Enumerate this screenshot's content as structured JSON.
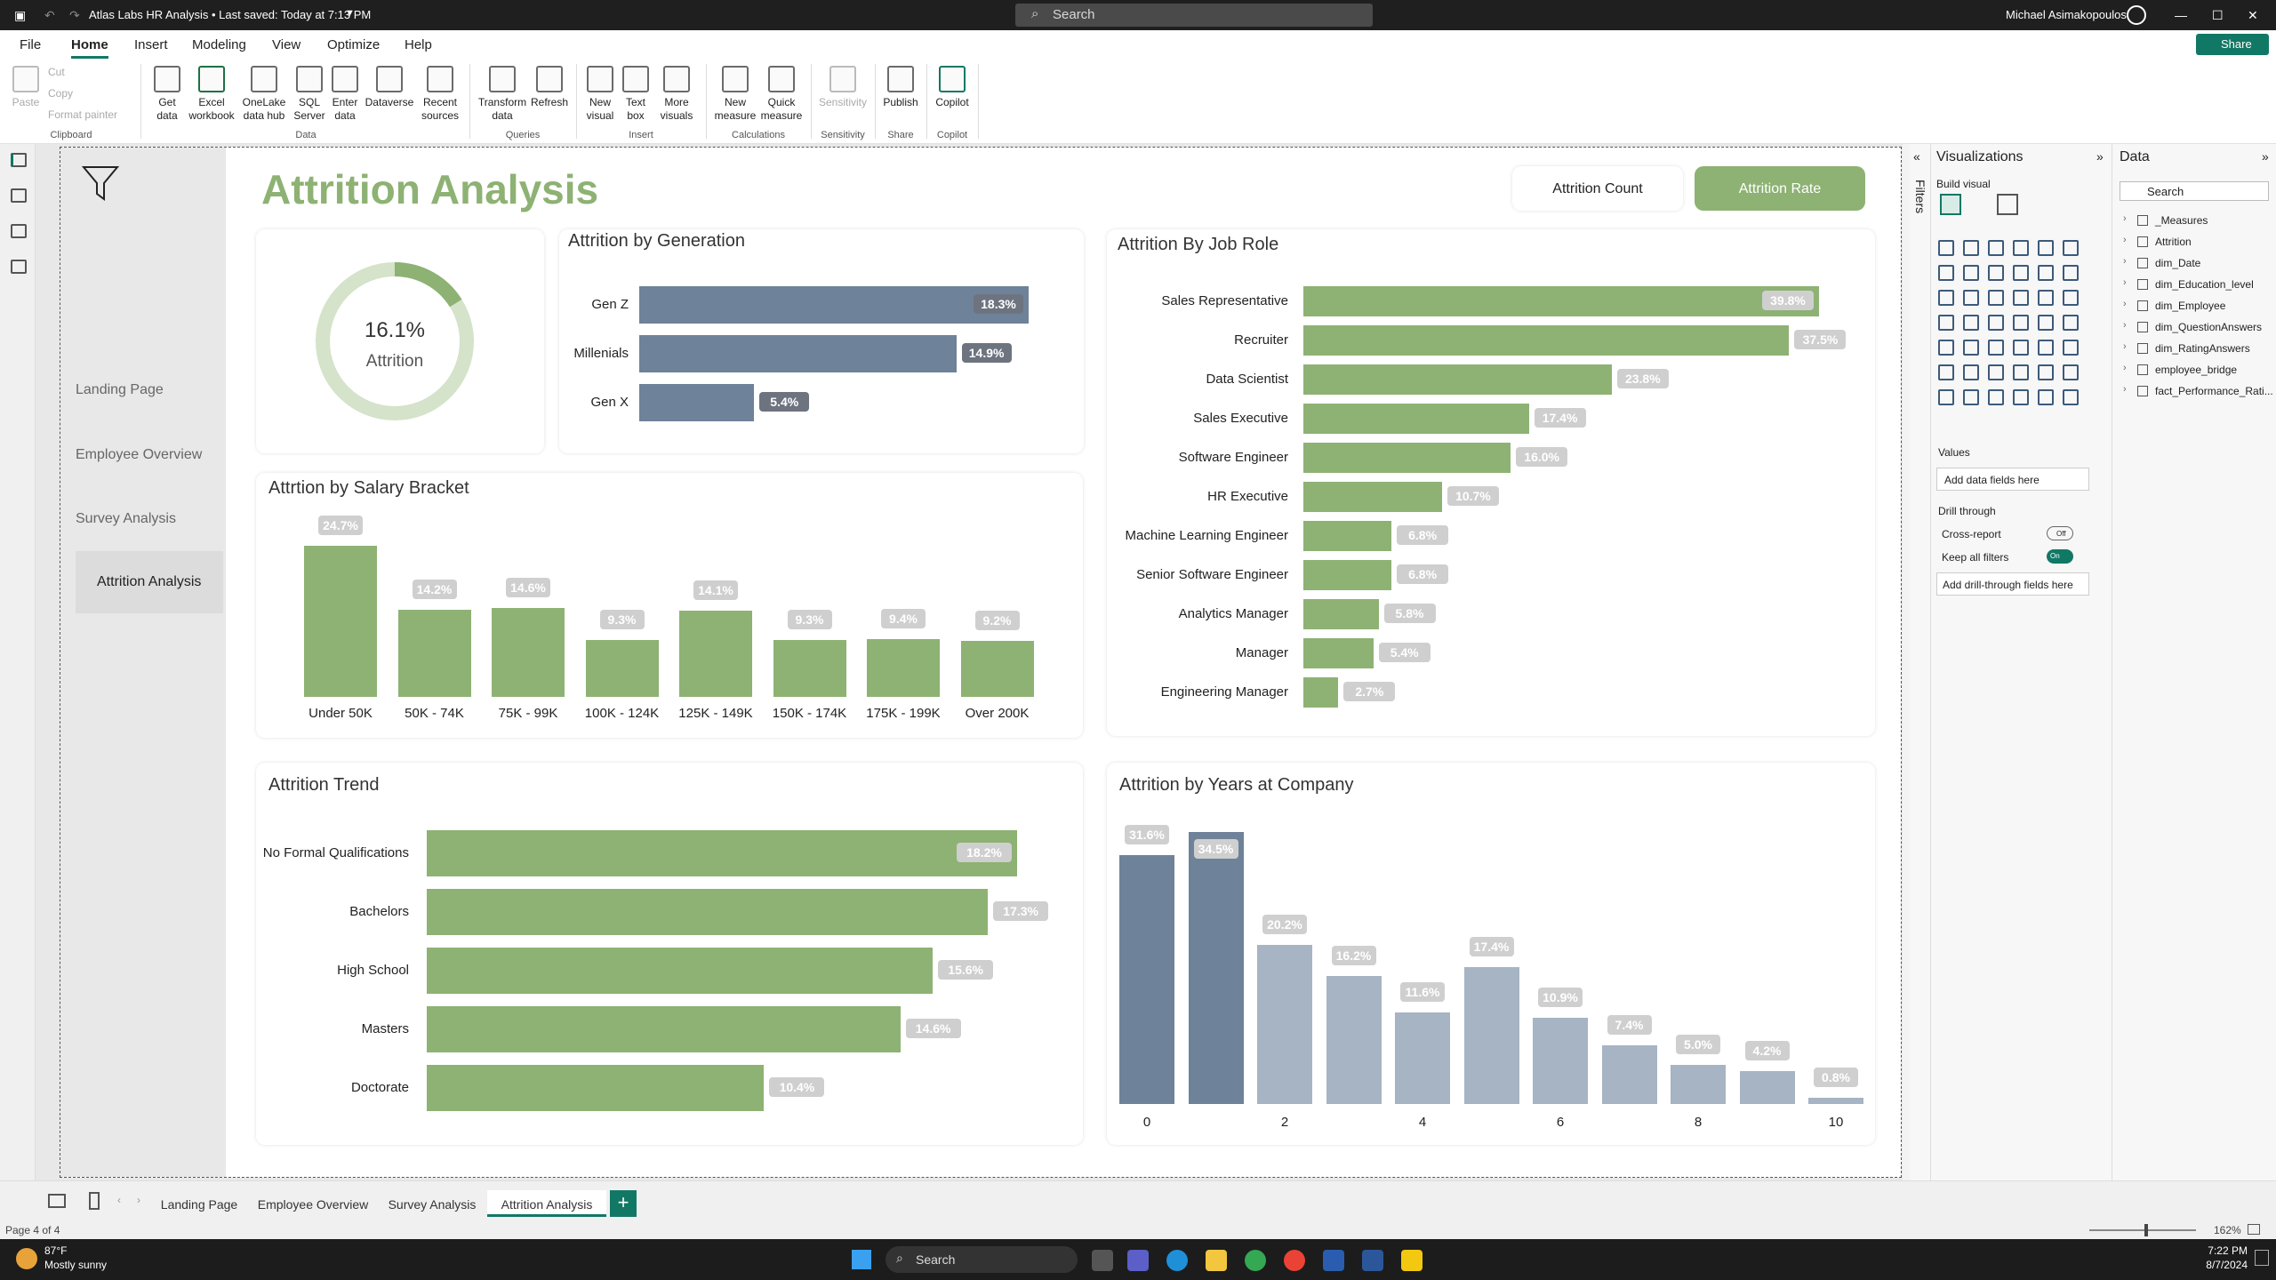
{
  "titlebar": {
    "title": "Atlas Labs HR Analysis • Last saved: Today at 7:13 PM",
    "search_placeholder": "Search",
    "user": "Michael Asimakopoulos",
    "share": "Share"
  },
  "menu": [
    "File",
    "Home",
    "Insert",
    "Modeling",
    "View",
    "Optimize",
    "Help"
  ],
  "ribbon": {
    "clipboard": {
      "paste": "Paste",
      "cut": "Cut",
      "copy": "Copy",
      "format_painter": "Format painter",
      "group": "Clipboard"
    },
    "data": {
      "items": [
        "Get data",
        "Excel workbook",
        "OneLake data hub",
        "SQL Server",
        "Enter data",
        "Dataverse",
        "Recent sources"
      ],
      "group": "Data"
    },
    "queries": {
      "items": [
        "Transform data",
        "Refresh"
      ],
      "group": "Queries"
    },
    "insert": {
      "items": [
        "New visual",
        "Text box",
        "More visuals"
      ],
      "group": "Insert"
    },
    "calculations": {
      "items": [
        "New measure",
        "Quick measure"
      ],
      "group": "Calculations"
    },
    "sensitivity": {
      "items": [
        "Sensitivity"
      ],
      "group": "Sensitivity"
    },
    "share": {
      "items": [
        "Publish"
      ],
      "group": "Share"
    },
    "copilot": {
      "items": [
        "Copilot"
      ],
      "group": "Copilot"
    }
  },
  "report": {
    "title": "Attrition Analysis",
    "toggle_count": "Attrition Count",
    "toggle_rate": "Attrition Rate",
    "nav": [
      "Landing Page",
      "Employee Overview",
      "Survey Analysis",
      "Attrition Analysis"
    ],
    "kpi": {
      "value": "16.1%",
      "label": "Attrition",
      "fraction": 0.161
    },
    "colors": {
      "green": "#8db273",
      "slate": "#6e8299",
      "slate_light": "#a6b4c4",
      "title_green": "#8db273"
    }
  },
  "chart_data": [
    {
      "type": "bar",
      "title": "Attrition by Generation",
      "orientation": "horizontal",
      "categories": [
        "Gen Z",
        "Millenials",
        "Gen X"
      ],
      "values": [
        18.3,
        14.9,
        5.4
      ],
      "labels": [
        "18.3%",
        "14.9%",
        "5.4%"
      ]
    },
    {
      "type": "bar",
      "title": "Attrition By Job Role",
      "orientation": "horizontal",
      "categories": [
        "Sales Representative",
        "Recruiter",
        "Data Scientist",
        "Sales Executive",
        "Software Engineer",
        "HR Executive",
        "Machine Learning Engineer",
        "Senior Software Engineer",
        "Analytics Manager",
        "Manager",
        "Engineering Manager"
      ],
      "values": [
        39.8,
        37.5,
        23.8,
        17.4,
        16.0,
        10.7,
        6.8,
        6.8,
        5.8,
        5.4,
        2.7
      ],
      "labels": [
        "39.8%",
        "37.5%",
        "23.8%",
        "17.4%",
        "16.0%",
        "10.7%",
        "6.8%",
        "6.8%",
        "5.8%",
        "5.4%",
        "2.7%"
      ]
    },
    {
      "type": "bar",
      "title": "Attrtion by Salary Bracket",
      "orientation": "vertical",
      "categories": [
        "Under 50K",
        "50K - 74K",
        "75K - 99K",
        "100K - 124K",
        "125K - 149K",
        "150K - 174K",
        "175K - 199K",
        "Over 200K"
      ],
      "values": [
        24.7,
        14.2,
        14.6,
        9.3,
        14.1,
        9.3,
        9.4,
        9.2
      ],
      "labels": [
        "24.7%",
        "14.2%",
        "14.6%",
        "9.3%",
        "14.1%",
        "9.3%",
        "9.4%",
        "9.2%"
      ]
    },
    {
      "type": "bar",
      "title": "Attrition Trend",
      "orientation": "horizontal",
      "categories": [
        "No Formal Qualifications",
        "Bachelors",
        "High School",
        "Masters",
        "Doctorate"
      ],
      "values": [
        18.2,
        17.3,
        15.6,
        14.6,
        10.4
      ],
      "labels": [
        "18.2%",
        "17.3%",
        "15.6%",
        "14.6%",
        "10.4%"
      ]
    },
    {
      "type": "bar",
      "title": "Attrition by Years at Company",
      "orientation": "vertical",
      "x": [
        0,
        1,
        2,
        3,
        4,
        5,
        6,
        7,
        8,
        9,
        10
      ],
      "tick_labels": [
        "0",
        "2",
        "4",
        "6",
        "8",
        "10"
      ],
      "values": [
        31.6,
        34.5,
        20.2,
        16.2,
        11.6,
        17.4,
        10.9,
        7.4,
        5.0,
        4.2,
        0.8
      ],
      "labels": [
        "31.6%",
        "34.5%",
        "20.2%",
        "16.2%",
        "11.6%",
        "17.4%",
        "10.9%",
        "7.4%",
        "5.0%",
        "4.2%",
        "0.8%"
      ]
    }
  ],
  "viz_pane": {
    "title": "Visualizations",
    "build": "Build visual",
    "values": "Values",
    "add_fields": "Add data fields here",
    "drill": "Drill through",
    "cross_report": "Cross-report",
    "cross_state": "Off",
    "keep_filters": "Keep all filters",
    "keep_state": "On",
    "add_drill": "Add drill-through fields here",
    "filters": "Filters"
  },
  "data_pane": {
    "title": "Data",
    "search": "Search",
    "tables": [
      "_Measures",
      "Attrition",
      "dim_Date",
      "dim_Education_level",
      "dim_Employee",
      "dim_QuestionAnswers",
      "dim_RatingAnswers",
      "employee_bridge",
      "fact_Performance_Rati..."
    ]
  },
  "pages": [
    "Landing Page",
    "Employee Overview",
    "Survey Analysis",
    "Attrition Analysis"
  ],
  "status": {
    "page": "Page 4 of 4",
    "zoom": "162%"
  },
  "taskbar": {
    "temp": "87°F",
    "weather": "Mostly sunny",
    "search": "Search",
    "time": "7:22 PM",
    "date": "8/7/2024"
  }
}
